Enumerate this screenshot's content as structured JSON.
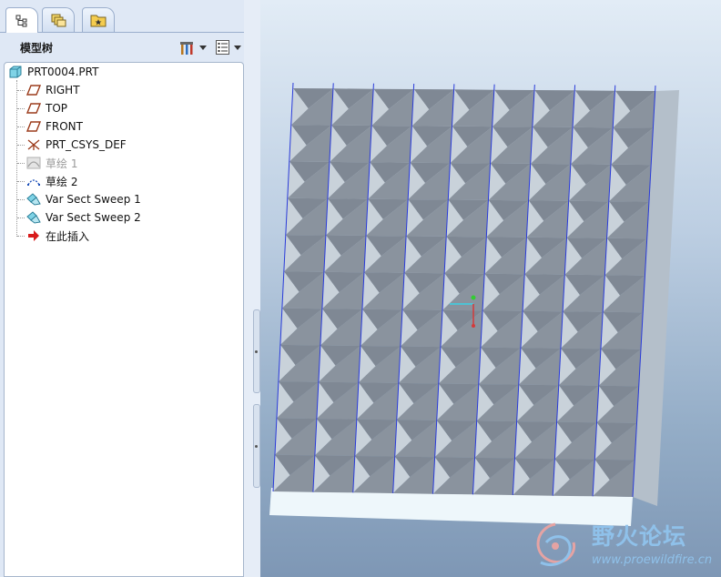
{
  "window": {
    "tabs": [
      {
        "icon": "model-tree-icon",
        "active": true
      },
      {
        "icon": "layers-icon",
        "active": false
      },
      {
        "icon": "folder-favorites-icon",
        "active": false
      }
    ]
  },
  "model_tree": {
    "title": "模型树",
    "header_buttons": [
      {
        "icon": "tree-settings-icon"
      },
      {
        "icon": "tree-filter-columns-icon"
      }
    ],
    "items": [
      {
        "label": "PRT0004.PRT",
        "icon": "part-icon",
        "enabled": true
      },
      {
        "label": "RIGHT",
        "icon": "datum-plane-icon",
        "enabled": true
      },
      {
        "label": "TOP",
        "icon": "datum-plane-icon",
        "enabled": true
      },
      {
        "label": "FRONT",
        "icon": "datum-plane-icon",
        "enabled": true
      },
      {
        "label": "PRT_CSYS_DEF",
        "icon": "coordinate-system-icon",
        "enabled": true
      },
      {
        "label": "草绘 1",
        "icon": "sketch-icon",
        "enabled": false
      },
      {
        "label": "草绘 2",
        "icon": "sketch-icon",
        "enabled": true
      },
      {
        "label": "Var Sect Sweep 1",
        "icon": "var-sect-sweep-icon",
        "enabled": true
      },
      {
        "label": "Var Sect Sweep 2",
        "icon": "var-sect-sweep-icon",
        "enabled": true
      },
      {
        "label": "在此插入",
        "icon": "insert-here-arrow-icon",
        "enabled": true
      }
    ]
  },
  "viewport": {
    "colors": {
      "face_light": "#c9d2da",
      "face_dark": "#7f8894",
      "edge": "#2a3bd9",
      "base": "#eef7fb"
    }
  },
  "watermark": {
    "title": "野火论坛",
    "url": "www.proewildfire.cn"
  }
}
